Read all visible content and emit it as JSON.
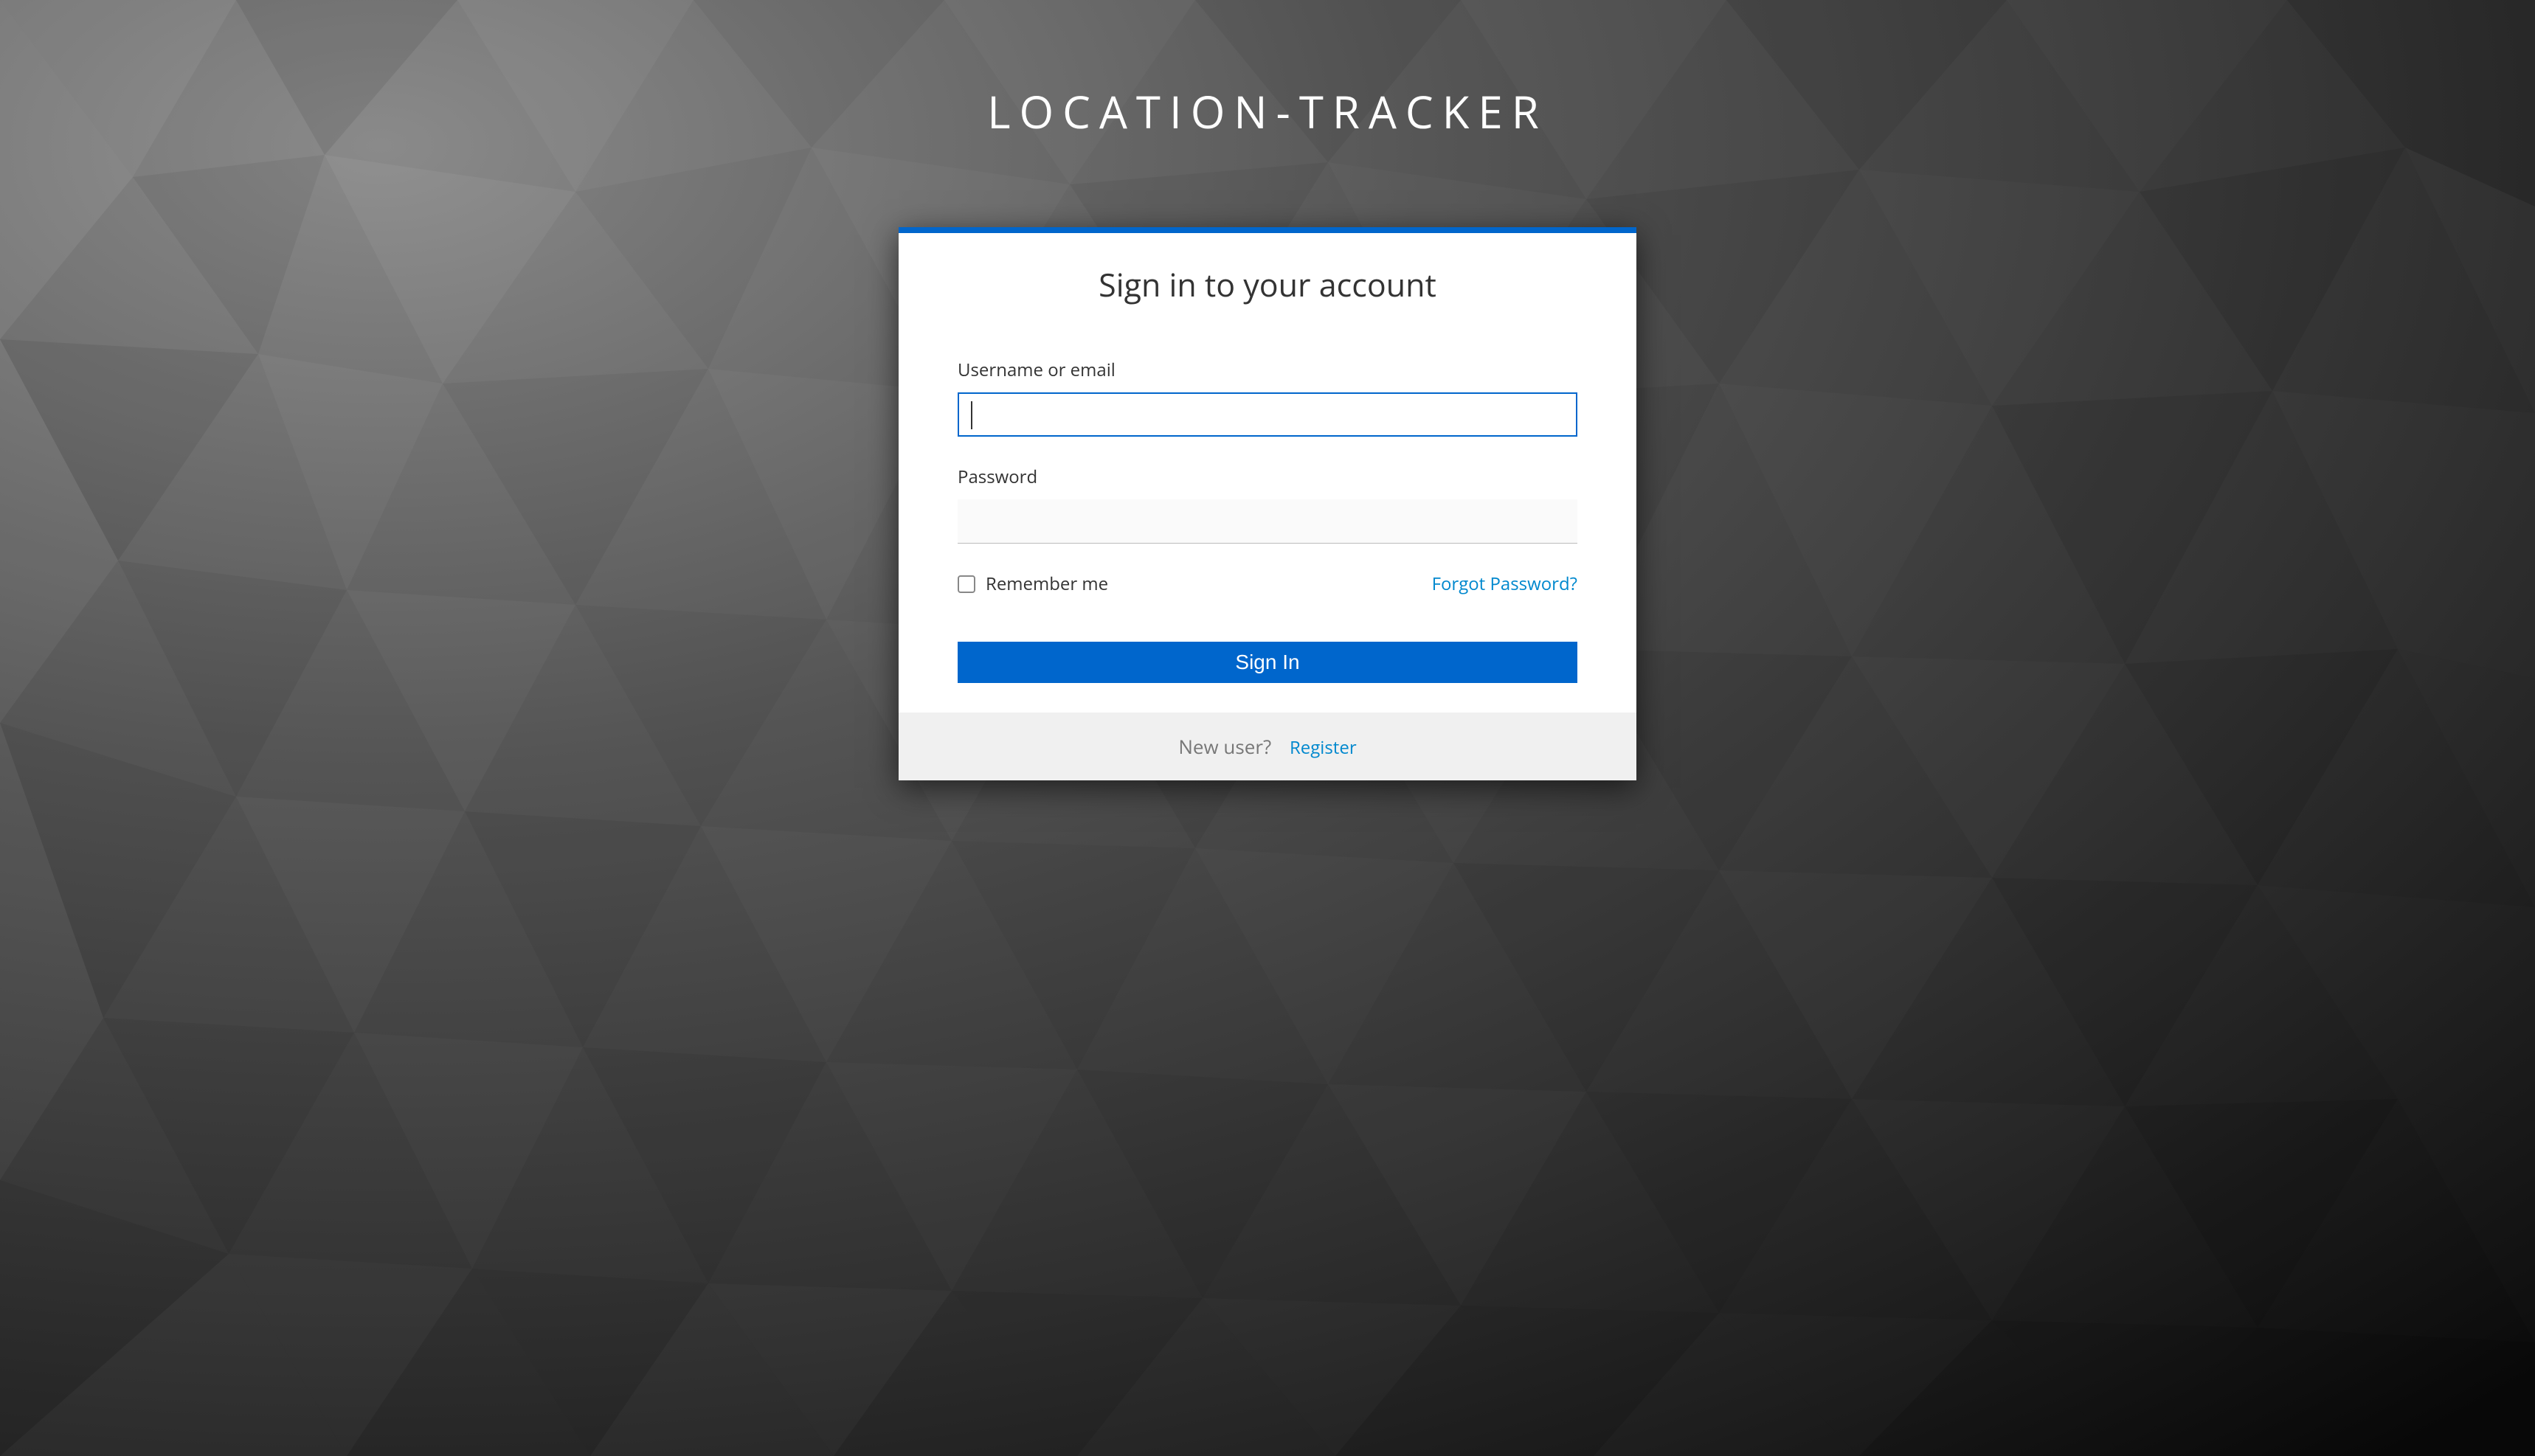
{
  "app": {
    "title": "LOCATION-TRACKER"
  },
  "card": {
    "heading": "Sign in to your account",
    "username_label": "Username or email",
    "username_value": "",
    "password_label": "Password",
    "password_value": "",
    "remember_label": "Remember me",
    "forgot_label": "Forgot Password?",
    "signin_label": "Sign In"
  },
  "footer": {
    "new_user_text": "New user?",
    "register_label": "Register"
  },
  "colors": {
    "accent": "#0066cc",
    "link": "#0088ce"
  }
}
